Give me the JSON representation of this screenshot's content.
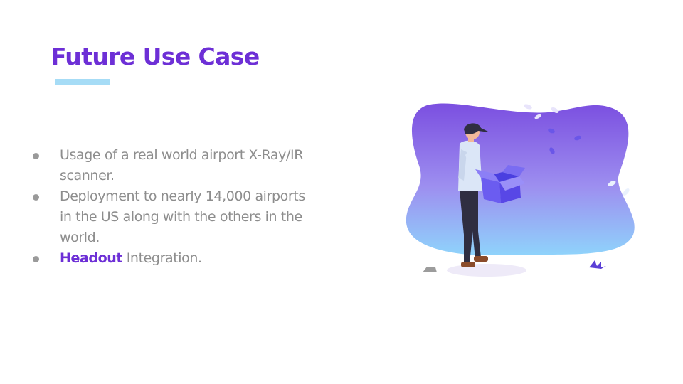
{
  "slide": {
    "title": "Future Use Case",
    "bullets": [
      {
        "highlight": "",
        "text": "Usage of a real world airport X-Ray/IR scanner."
      },
      {
        "highlight": "",
        "text": "Deployment to nearly 14,000 airports in the US along with the others in the world."
      },
      {
        "highlight": "Headout",
        "text": " Integration."
      }
    ]
  },
  "colors": {
    "title": "#6d2fd6",
    "accent_bar": "#a6dcf6",
    "body_text": "#8d8d8d",
    "blob_top": "#7b4fe0",
    "blob_bottom": "#8fd3fb"
  },
  "illustration": {
    "subject": "person-holding-open-box-icon"
  }
}
